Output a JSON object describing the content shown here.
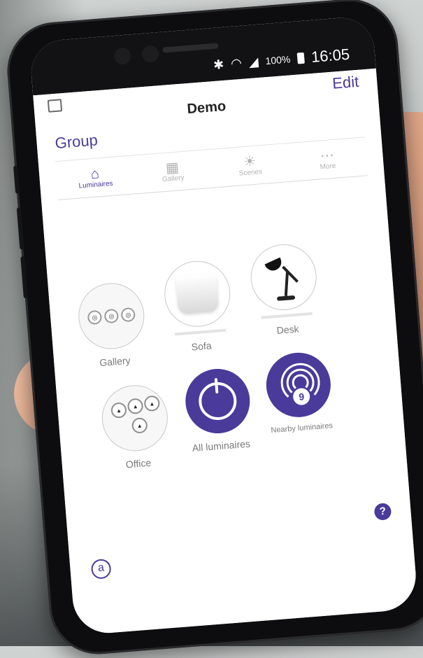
{
  "status": {
    "battery_percent": "100%",
    "time": "16:05",
    "icons": [
      "bluetooth-icon",
      "wifi-icon",
      "signal-icon",
      "battery-icon"
    ]
  },
  "appbar": {
    "title": "Demo",
    "edit_label": "Edit",
    "group_label": "Group"
  },
  "tabs": [
    {
      "label": "Luminaires",
      "icon": "lamp-icon",
      "active": true
    },
    {
      "label": "Gallery",
      "icon": "grid-icon",
      "active": false
    },
    {
      "label": "Scenes",
      "icon": "sun-icon",
      "active": false
    },
    {
      "label": "More",
      "icon": "more-icon",
      "active": false
    }
  ],
  "items": {
    "gallery": {
      "label": "Gallery"
    },
    "sofa": {
      "label": "Sofa"
    },
    "desk": {
      "label": "Desk"
    },
    "office": {
      "label": "Office"
    },
    "all": {
      "label": "All luminaires"
    },
    "nearby": {
      "label": "Nearby luminaires",
      "count": "9"
    }
  },
  "help": {
    "label": "?"
  },
  "brand": {
    "label": "a"
  },
  "colors": {
    "accent": "#4a3a9a"
  }
}
